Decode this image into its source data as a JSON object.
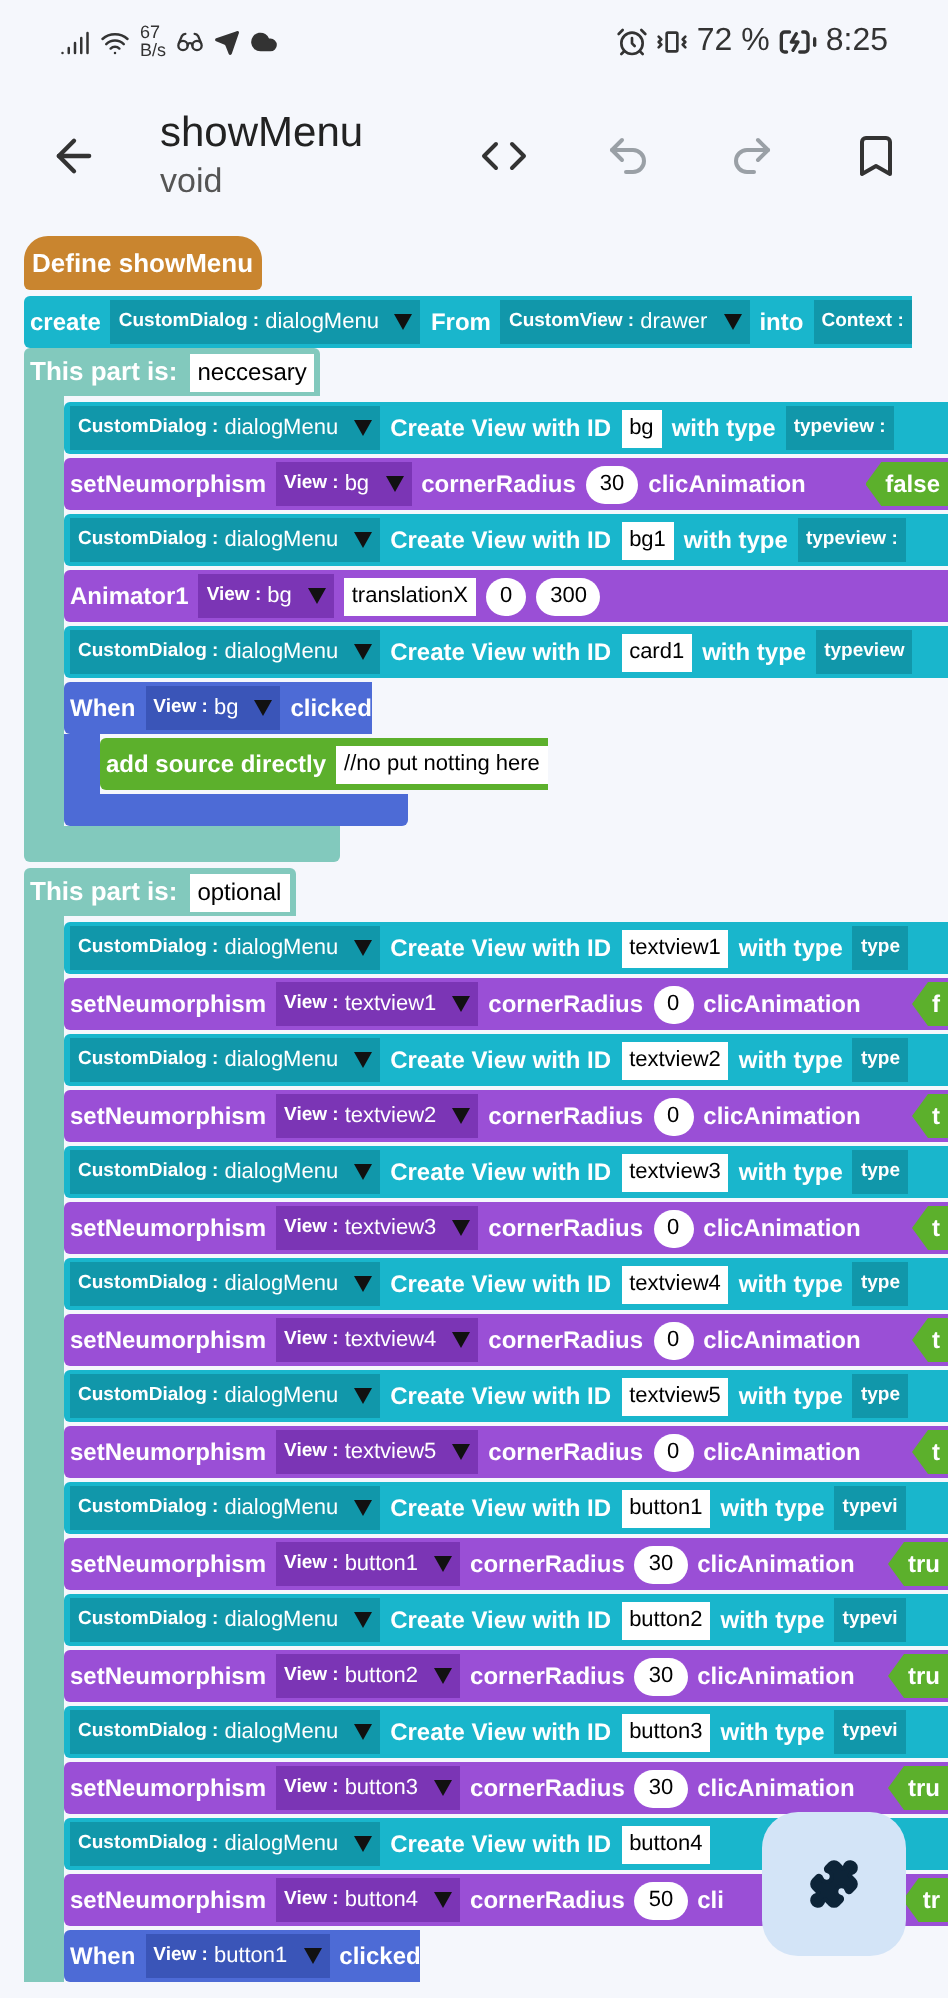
{
  "status_bar": {
    "speed_value": "67",
    "speed_unit": "B/s",
    "battery_percent": "72 %",
    "time": "8:25"
  },
  "header": {
    "title": "showMenu",
    "subtitle": "void",
    "actions": [
      {
        "kind": "code",
        "disabled": false
      },
      {
        "kind": "undo",
        "disabled": true
      },
      {
        "kind": "redo",
        "disabled": true
      },
      {
        "kind": "bookmark",
        "disabled": false
      }
    ]
  },
  "define_block": {
    "text": "Define showMenu"
  },
  "create_block": {
    "parts": [
      {
        "kind": "text",
        "text": "create"
      },
      {
        "kind": "dropdown",
        "type": "CustomDialog :",
        "value": "dialogMenu"
      },
      {
        "kind": "text",
        "text": "From"
      },
      {
        "kind": "dropdown",
        "type": "CustomView :",
        "value": "drawer"
      },
      {
        "kind": "text",
        "text": "into"
      },
      {
        "kind": "dropdown",
        "type": "Context :"
      }
    ]
  },
  "sections": [
    {
      "label": "This part is:",
      "value": "neccesary",
      "blocks": [
        {
          "kind": "create_view",
          "parts": [
            {
              "kind": "dropdown",
              "type": "CustomDialog :",
              "value": "dialogMenu"
            },
            {
              "kind": "text",
              "text": "Create View with ID"
            },
            {
              "kind": "field",
              "text": "bg"
            },
            {
              "kind": "text",
              "text": "with type"
            },
            {
              "kind": "dropdown",
              "type": "typeview :"
            }
          ]
        },
        {
          "kind": "neumorphism",
          "parts": [
            {
              "kind": "text",
              "text": "setNeumorphism"
            },
            {
              "kind": "dropdown",
              "type": "View :",
              "value": "bg"
            },
            {
              "kind": "text",
              "text": "cornerRadius"
            },
            {
              "kind": "number",
              "text": "30"
            },
            {
              "kind": "text",
              "text": "clicAnimation"
            },
            {
              "kind": "bool",
              "text": "false"
            }
          ]
        },
        {
          "kind": "create_view",
          "parts": [
            {
              "kind": "dropdown",
              "type": "CustomDialog :",
              "value": "dialogMenu"
            },
            {
              "kind": "text",
              "text": "Create View with ID"
            },
            {
              "kind": "field",
              "text": "bg1"
            },
            {
              "kind": "text",
              "text": "with type"
            },
            {
              "kind": "dropdown",
              "type": "typeview :"
            }
          ]
        },
        {
          "kind": "animator",
          "parts": [
            {
              "kind": "text",
              "text": "Animator1"
            },
            {
              "kind": "dropdown",
              "type": "View :",
              "value": "bg"
            },
            {
              "kind": "field",
              "text": "translationX"
            },
            {
              "kind": "number",
              "text": "0"
            },
            {
              "kind": "number",
              "text": "300"
            }
          ]
        },
        {
          "kind": "create_view",
          "parts": [
            {
              "kind": "dropdown",
              "type": "CustomDialog :",
              "value": "dialogMenu"
            },
            {
              "kind": "text",
              "text": "Create View with ID"
            },
            {
              "kind": "field",
              "text": "card1"
            },
            {
              "kind": "text",
              "text": "with type"
            },
            {
              "kind": "dropdown",
              "type": "typeview"
            }
          ]
        },
        {
          "kind": "event",
          "parts": [
            {
              "kind": "text",
              "text": "When"
            },
            {
              "kind": "dropdown",
              "type": "View :",
              "value": "bg"
            },
            {
              "kind": "text",
              "text": "clicked"
            }
          ],
          "children": [
            {
              "kind": "source",
              "parts": [
                {
                  "kind": "text",
                  "text": "add source directly"
                },
                {
                  "kind": "field",
                  "text": "//no put notting here"
                }
              ]
            }
          ]
        }
      ]
    },
    {
      "label": "This part is:",
      "value": "optional",
      "blocks": [
        {
          "kind": "create_view",
          "parts": [
            {
              "kind": "dropdown",
              "type": "CustomDialog :",
              "value": "dialogMenu"
            },
            {
              "kind": "text",
              "text": "Create View with ID"
            },
            {
              "kind": "field",
              "text": "textview1"
            },
            {
              "kind": "text",
              "text": "with type"
            },
            {
              "kind": "dropdown",
              "type": "type"
            }
          ]
        },
        {
          "kind": "neumorphism",
          "parts": [
            {
              "kind": "text",
              "text": "setNeumorphism"
            },
            {
              "kind": "dropdown",
              "type": "View :",
              "value": "textview1"
            },
            {
              "kind": "text",
              "text": "cornerRadius"
            },
            {
              "kind": "number",
              "text": "0"
            },
            {
              "kind": "text",
              "text": "clicAnimation"
            },
            {
              "kind": "bool",
              "text": "f"
            }
          ]
        },
        {
          "kind": "create_view",
          "parts": [
            {
              "kind": "dropdown",
              "type": "CustomDialog :",
              "value": "dialogMenu"
            },
            {
              "kind": "text",
              "text": "Create View with ID"
            },
            {
              "kind": "field",
              "text": "textview2"
            },
            {
              "kind": "text",
              "text": "with type"
            },
            {
              "kind": "dropdown",
              "type": "type"
            }
          ]
        },
        {
          "kind": "neumorphism",
          "parts": [
            {
              "kind": "text",
              "text": "setNeumorphism"
            },
            {
              "kind": "dropdown",
              "type": "View :",
              "value": "textview2"
            },
            {
              "kind": "text",
              "text": "cornerRadius"
            },
            {
              "kind": "number",
              "text": "0"
            },
            {
              "kind": "text",
              "text": "clicAnimation"
            },
            {
              "kind": "bool",
              "text": "t"
            }
          ]
        },
        {
          "kind": "create_view",
          "parts": [
            {
              "kind": "dropdown",
              "type": "CustomDialog :",
              "value": "dialogMenu"
            },
            {
              "kind": "text",
              "text": "Create View with ID"
            },
            {
              "kind": "field",
              "text": "textview3"
            },
            {
              "kind": "text",
              "text": "with type"
            },
            {
              "kind": "dropdown",
              "type": "type"
            }
          ]
        },
        {
          "kind": "neumorphism",
          "parts": [
            {
              "kind": "text",
              "text": "setNeumorphism"
            },
            {
              "kind": "dropdown",
              "type": "View :",
              "value": "textview3"
            },
            {
              "kind": "text",
              "text": "cornerRadius"
            },
            {
              "kind": "number",
              "text": "0"
            },
            {
              "kind": "text",
              "text": "clicAnimation"
            },
            {
              "kind": "bool",
              "text": "t"
            }
          ]
        },
        {
          "kind": "create_view",
          "parts": [
            {
              "kind": "dropdown",
              "type": "CustomDialog :",
              "value": "dialogMenu"
            },
            {
              "kind": "text",
              "text": "Create View with ID"
            },
            {
              "kind": "field",
              "text": "textview4"
            },
            {
              "kind": "text",
              "text": "with type"
            },
            {
              "kind": "dropdown",
              "type": "type"
            }
          ]
        },
        {
          "kind": "neumorphism",
          "parts": [
            {
              "kind": "text",
              "text": "setNeumorphism"
            },
            {
              "kind": "dropdown",
              "type": "View :",
              "value": "textview4"
            },
            {
              "kind": "text",
              "text": "cornerRadius"
            },
            {
              "kind": "number",
              "text": "0"
            },
            {
              "kind": "text",
              "text": "clicAnimation"
            },
            {
              "kind": "bool",
              "text": "t"
            }
          ]
        },
        {
          "kind": "create_view",
          "parts": [
            {
              "kind": "dropdown",
              "type": "CustomDialog :",
              "value": "dialogMenu"
            },
            {
              "kind": "text",
              "text": "Create View with ID"
            },
            {
              "kind": "field",
              "text": "textview5"
            },
            {
              "kind": "text",
              "text": "with type"
            },
            {
              "kind": "dropdown",
              "type": "type"
            }
          ]
        },
        {
          "kind": "neumorphism",
          "parts": [
            {
              "kind": "text",
              "text": "setNeumorphism"
            },
            {
              "kind": "dropdown",
              "type": "View :",
              "value": "textview5"
            },
            {
              "kind": "text",
              "text": "cornerRadius"
            },
            {
              "kind": "number",
              "text": "0"
            },
            {
              "kind": "text",
              "text": "clicAnimation"
            },
            {
              "kind": "bool",
              "text": "t"
            }
          ]
        },
        {
          "kind": "create_view",
          "parts": [
            {
              "kind": "dropdown",
              "type": "CustomDialog :",
              "value": "dialogMenu"
            },
            {
              "kind": "text",
              "text": "Create View with ID"
            },
            {
              "kind": "field",
              "text": "button1"
            },
            {
              "kind": "text",
              "text": "with type"
            },
            {
              "kind": "dropdown",
              "type": "typevi"
            }
          ]
        },
        {
          "kind": "neumorphism",
          "parts": [
            {
              "kind": "text",
              "text": "setNeumorphism"
            },
            {
              "kind": "dropdown",
              "type": "View :",
              "value": "button1"
            },
            {
              "kind": "text",
              "text": "cornerRadius"
            },
            {
              "kind": "number",
              "text": "30"
            },
            {
              "kind": "text",
              "text": "clicAnimation"
            },
            {
              "kind": "bool",
              "text": "tru"
            }
          ]
        },
        {
          "kind": "create_view",
          "parts": [
            {
              "kind": "dropdown",
              "type": "CustomDialog :",
              "value": "dialogMenu"
            },
            {
              "kind": "text",
              "text": "Create View with ID"
            },
            {
              "kind": "field",
              "text": "button2"
            },
            {
              "kind": "text",
              "text": "with type"
            },
            {
              "kind": "dropdown",
              "type": "typevi"
            }
          ]
        },
        {
          "kind": "neumorphism",
          "parts": [
            {
              "kind": "text",
              "text": "setNeumorphism"
            },
            {
              "kind": "dropdown",
              "type": "View :",
              "value": "button2"
            },
            {
              "kind": "text",
              "text": "cornerRadius"
            },
            {
              "kind": "number",
              "text": "30"
            },
            {
              "kind": "text",
              "text": "clicAnimation"
            },
            {
              "kind": "bool",
              "text": "tru"
            }
          ]
        },
        {
          "kind": "create_view",
          "parts": [
            {
              "kind": "dropdown",
              "type": "CustomDialog :",
              "value": "dialogMenu"
            },
            {
              "kind": "text",
              "text": "Create View with ID"
            },
            {
              "kind": "field",
              "text": "button3"
            },
            {
              "kind": "text",
              "text": "with type"
            },
            {
              "kind": "dropdown",
              "type": "typevi"
            }
          ]
        },
        {
          "kind": "neumorphism",
          "parts": [
            {
              "kind": "text",
              "text": "setNeumorphism"
            },
            {
              "kind": "dropdown",
              "type": "View :",
              "value": "button3"
            },
            {
              "kind": "text",
              "text": "cornerRadius"
            },
            {
              "kind": "number",
              "text": "30"
            },
            {
              "kind": "text",
              "text": "clicAnimation"
            },
            {
              "kind": "bool",
              "text": "tru"
            }
          ]
        },
        {
          "kind": "create_view",
          "parts": [
            {
              "kind": "dropdown",
              "type": "CustomDialog :",
              "value": "dialogMenu"
            },
            {
              "kind": "text",
              "text": "Create View with ID"
            },
            {
              "kind": "field",
              "text": "button4"
            }
          ]
        },
        {
          "kind": "neumorphism",
          "parts": [
            {
              "kind": "text",
              "text": "setNeumorphism"
            },
            {
              "kind": "dropdown",
              "type": "View :",
              "value": "button4"
            },
            {
              "kind": "text",
              "text": "cornerRadius"
            },
            {
              "kind": "number",
              "text": "50"
            },
            {
              "kind": "text",
              "text": "cli"
            },
            {
              "kind": "bool",
              "text": "tr"
            }
          ]
        },
        {
          "kind": "event",
          "parts": [
            {
              "kind": "text",
              "text": "When"
            },
            {
              "kind": "dropdown",
              "type": "View :",
              "value": "button1"
            },
            {
              "kind": "text",
              "text": "clicked"
            }
          ]
        }
      ]
    }
  ]
}
